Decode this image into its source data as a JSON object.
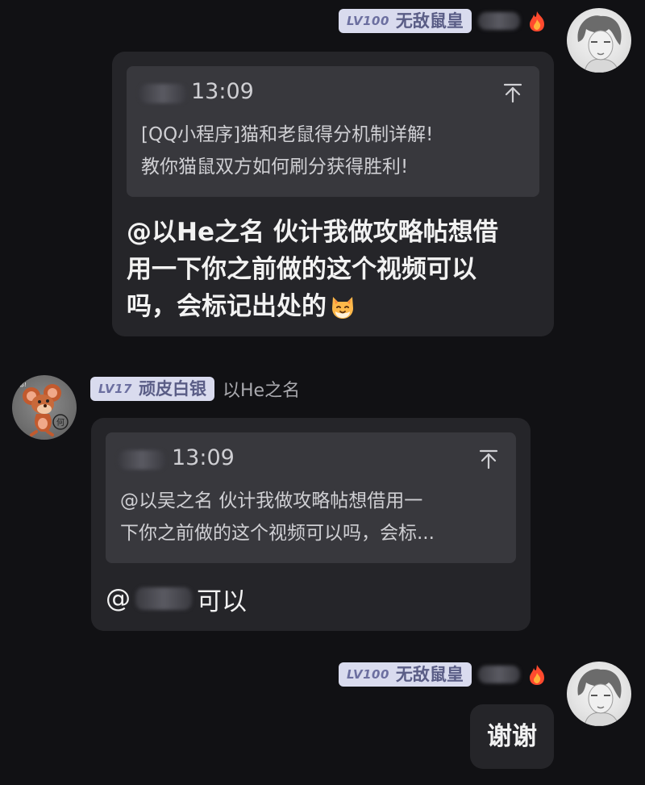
{
  "messages": [
    {
      "sender": {
        "level": "LV100",
        "name": "无敌鼠皇",
        "badge_icon": "fire-icon"
      },
      "quote": {
        "time": "13:09",
        "text_line1": "[QQ小程序]猫和老鼠得分机制详解!",
        "text_line2": "教你猫鼠双方如何刷分获得胜利!"
      },
      "body": {
        "line1": "@以He之名 伙计我做攻略帖想借",
        "line2": "用一下你之前做的这个视频可以",
        "line3": "吗，会标记出处的",
        "emoji": "cat-face-emoji"
      }
    },
    {
      "sender": {
        "level": "LV17",
        "name": "顽皮白银",
        "nickname": "以He之名"
      },
      "quote": {
        "time": "13:09",
        "text_line1": "@以吴之名 伙计我做攻略帖想借用一",
        "text_line2": "下你之前做的这个视频可以吗，会标..."
      },
      "body": {
        "prefix": "@",
        "text": "可以"
      }
    },
    {
      "sender": {
        "level": "LV100",
        "name": "无敌鼠皇",
        "badge_icon": "fire-icon"
      },
      "body": {
        "text": "谢谢"
      }
    }
  ],
  "icons": {
    "jump_up": "arrow-up-to-top-icon"
  },
  "colors": {
    "background": "#111114",
    "bubble": "#252529",
    "quote": "#38383d",
    "badge_bg": "#d9dbee",
    "badge_text": "#5a5d86"
  }
}
